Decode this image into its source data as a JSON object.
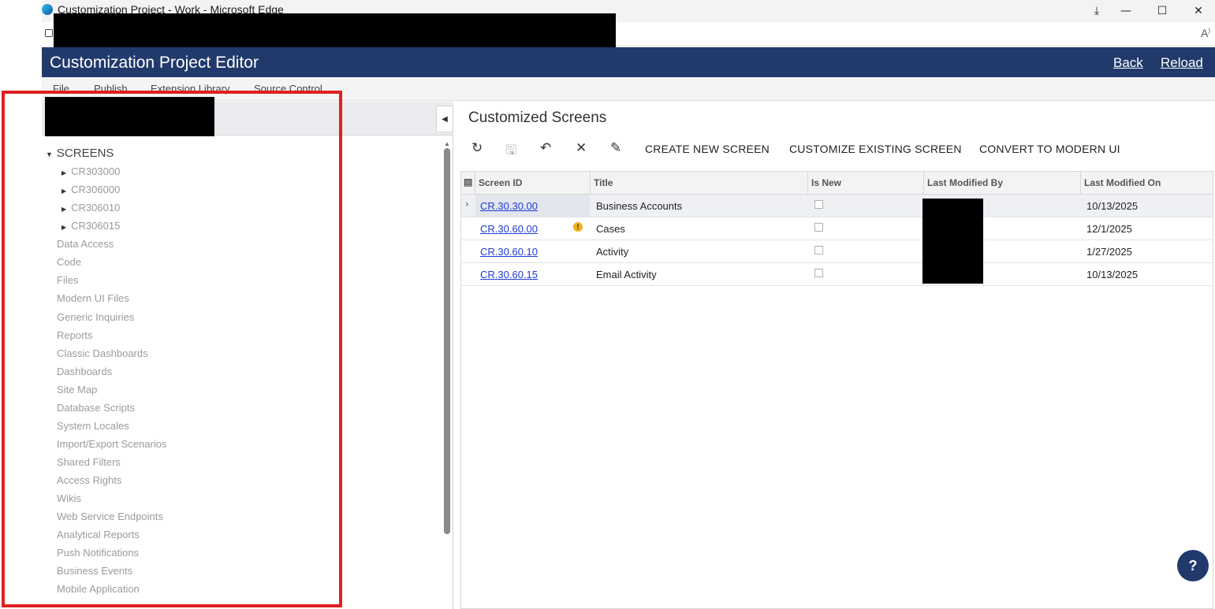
{
  "window": {
    "title": "Customization Project - Work - Microsoft Edge",
    "minimize": "—",
    "maximize": "☐",
    "close": "✕",
    "download_icon": "download-icon",
    "read_aloud": "À"
  },
  "header": {
    "title": "Customization Project Editor",
    "back": "Back",
    "reload": "Reload",
    "color": "#213a6b"
  },
  "menu": [
    "File",
    "Publish",
    "Extension Library",
    "Source Control"
  ],
  "tree": {
    "root": "SCREENS",
    "screens": [
      "CR303000",
      "CR306000",
      "CR306010",
      "CR306015"
    ],
    "items": [
      "Data Access",
      "Code",
      "Files",
      "Modern UI Files",
      "Generic Inquiries",
      "Reports",
      "Classic Dashboards",
      "Dashboards",
      "Site Map",
      "Database Scripts",
      "System Locales",
      "Import/Export Scenarios",
      "Shared Filters",
      "Access Rights",
      "Wikis",
      "Web Service Endpoints",
      "Analytical Reports",
      "Push Notifications",
      "Business Events",
      "Mobile Application"
    ]
  },
  "main": {
    "title": "Customized Screens",
    "toolbar": {
      "create": "CREATE NEW SCREEN",
      "customize": "CUSTOMIZE EXISTING SCREEN",
      "convert": "CONVERT TO MODERN UI"
    },
    "columns": [
      "Screen ID",
      "Title",
      "Is New",
      "Last Modified By",
      "Last Modified On"
    ],
    "rows": [
      {
        "id": "CR.30.30.00",
        "title": "Business Accounts",
        "is_new": false,
        "modified_on": "10/13/2025",
        "warning": false
      },
      {
        "id": "CR.30.60.00",
        "title": "Cases",
        "is_new": false,
        "modified_on": "12/1/2025",
        "warning": true
      },
      {
        "id": "CR.30.60.10",
        "title": "Activity",
        "is_new": false,
        "modified_on": "1/27/2025",
        "warning": false
      },
      {
        "id": "CR.30.60.15",
        "title": "Email Activity",
        "is_new": false,
        "modified_on": "10/13/2025",
        "warning": false
      }
    ]
  },
  "colors": {
    "highlight": "#e02020",
    "link": "#1f3bd6",
    "warning": "#f2b01e"
  }
}
